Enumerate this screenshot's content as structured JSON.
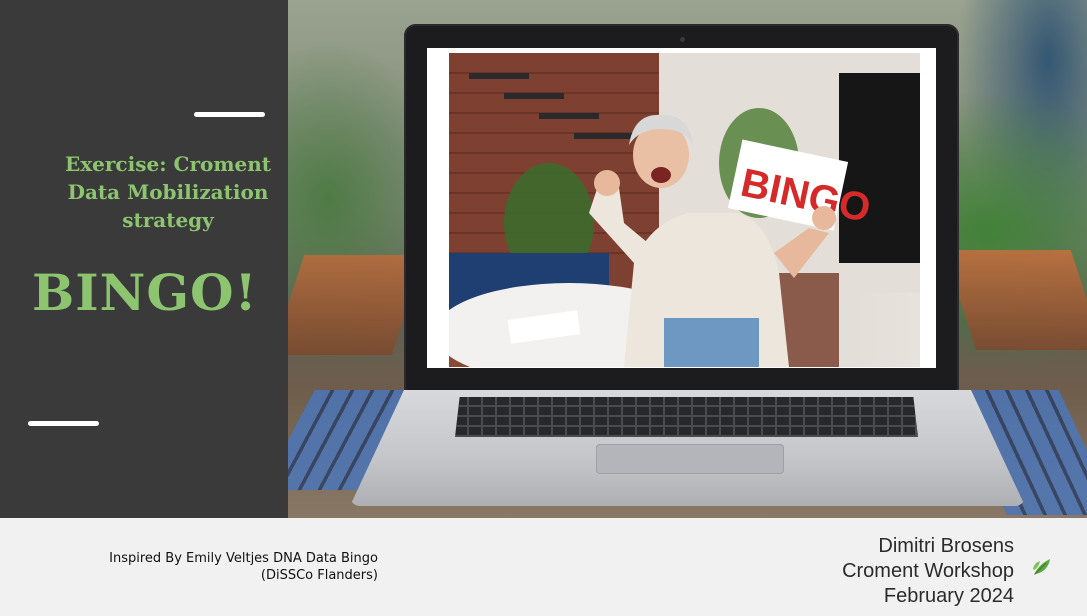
{
  "slide": {
    "exercise_title": [
      "Exercise: Croment",
      "Data Mobilization",
      "strategy"
    ],
    "bingo_title": "BINGO!",
    "screen_sign_text": "BINGO"
  },
  "footer": {
    "credit": [
      "Inspired By Emily Veltjes DNA Data Bingo",
      "(DiSSCo Flanders)"
    ],
    "author": [
      "Dimitri Brosens",
      "Croment Workshop",
      "February 2024"
    ],
    "logo_icon": "leaf-icon"
  },
  "colors": {
    "title_green": "#8cc470",
    "panel_dark": "#3a3a3a",
    "footer_bg": "#f1f1f1",
    "logo_green": "#5aa83c",
    "sign_red": "#d42a2a"
  }
}
